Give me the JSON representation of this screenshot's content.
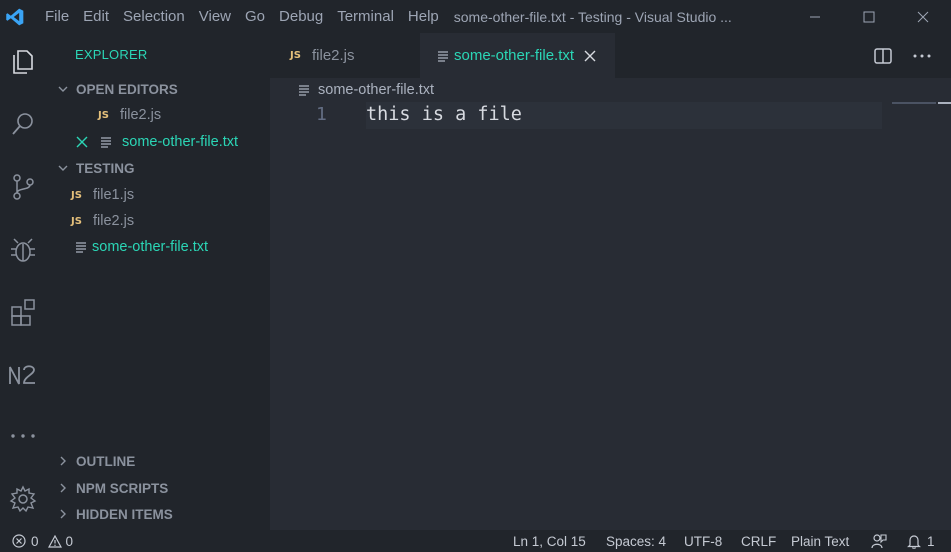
{
  "titlebar": {
    "menu": [
      "File",
      "Edit",
      "Selection",
      "View",
      "Go",
      "Debug",
      "Terminal",
      "Help"
    ],
    "title": "some-other-file.txt - Testing - Visual Studio ..."
  },
  "activitybar": {
    "icons": [
      "files-icon",
      "search-icon",
      "source-control-icon",
      "debug-icon",
      "extensions-icon",
      "n2-icon",
      "more-icon",
      "settings-gear-icon"
    ]
  },
  "sidebar": {
    "title": "EXPLORER",
    "open_editors": {
      "header": "OPEN EDITORS",
      "items": [
        {
          "badge": "JS",
          "label": "file2.js"
        },
        {
          "label": "some-other-file.txt"
        }
      ]
    },
    "workspace": {
      "header": "TESTING",
      "items": [
        {
          "badge": "JS",
          "label": "file1.js"
        },
        {
          "badge": "JS",
          "label": "file2.js"
        },
        {
          "label": "some-other-file.txt"
        }
      ]
    },
    "outline": "OUTLINE",
    "npm_scripts": "NPM SCRIPTS",
    "hidden_items": "HIDDEN ITEMS"
  },
  "editor": {
    "tabs": [
      {
        "badge": "JS",
        "label": "file2.js"
      },
      {
        "label": "some-other-file.txt"
      }
    ],
    "breadcrumb": "some-other-file.txt",
    "lines": [
      {
        "number": "1",
        "text": "this is a file"
      }
    ]
  },
  "statusbar": {
    "errors": "0",
    "warnings": "0",
    "position": "Ln 1, Col 15",
    "spaces": "Spaces: 4",
    "encoding": "UTF-8",
    "eol": "CRLF",
    "language": "Plain Text",
    "notifications": "1"
  },
  "colors": {
    "accent": "#2bd6b6",
    "js": "#e5c07b",
    "vscode_blue": "#3aa4f5"
  }
}
